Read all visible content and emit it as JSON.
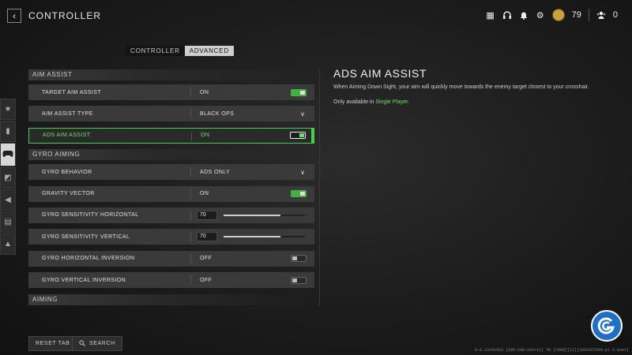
{
  "header": {
    "title": "CONTROLLER",
    "currency_value": "79",
    "party_count": "0"
  },
  "tabs": [
    {
      "label": "CONTROLLER",
      "active": false
    },
    {
      "label": "ADVANCED",
      "active": true
    }
  ],
  "sections": {
    "aim_assist": "AIM ASSIST",
    "gyro_aiming": "GYRO AIMING",
    "aiming": "AIMING"
  },
  "rows": {
    "target_aim_assist": {
      "label": "TARGET AIM ASSIST",
      "value": "ON",
      "state": "on"
    },
    "aim_assist_type": {
      "label": "AIM ASSIST TYPE",
      "value": "BLACK OPS"
    },
    "ads_aim_assist": {
      "label": "ADS AIM ASSIST",
      "value": "ON",
      "state": "on"
    },
    "gyro_behavior": {
      "label": "GYRO BEHAVIOR",
      "value": "ADS ONLY"
    },
    "gravity_vector": {
      "label": "GRAVITY VECTOR",
      "value": "ON",
      "state": "on"
    },
    "gyro_sens_h": {
      "label": "GYRO SENSITIVITY HORIZONTAL",
      "value": "70",
      "fill": 0.7
    },
    "gyro_sens_v": {
      "label": "GYRO SENSITIVITY VERTICAL",
      "value": "70",
      "fill": 0.7
    },
    "gyro_h_inv": {
      "label": "GYRO HORIZONTAL INVERSION",
      "value": "OFF",
      "state": "off"
    },
    "gyro_v_inv": {
      "label": "GYRO VERTICAL INVERSION",
      "value": "OFF",
      "state": "off"
    }
  },
  "detail": {
    "title": "ADS AIM ASSIST",
    "description": "When Aiming Down Sight, your aim will quickly move towards the enemy target closest to your crosshair.",
    "note_prefix": "Only available in ",
    "note_link": "Single Player",
    "note_suffix": "."
  },
  "footer": {
    "reset_label": "RESET TAB",
    "search_label": "SEARCH",
    "version": "9.8.13241923 [295:100:161+11] Tm [7000][1I][1663167034.pl.S.bnet]"
  },
  "colors": {
    "accent_green": "#45d248",
    "logo_blue": "#1e6fc9"
  },
  "icons": {
    "back": "chevron-left",
    "top": [
      "grid",
      "headset",
      "bell",
      "gear",
      "medal",
      "party"
    ],
    "rail": [
      "star",
      "weapon",
      "controller",
      "gyro",
      "audio",
      "interface",
      "account"
    ]
  }
}
